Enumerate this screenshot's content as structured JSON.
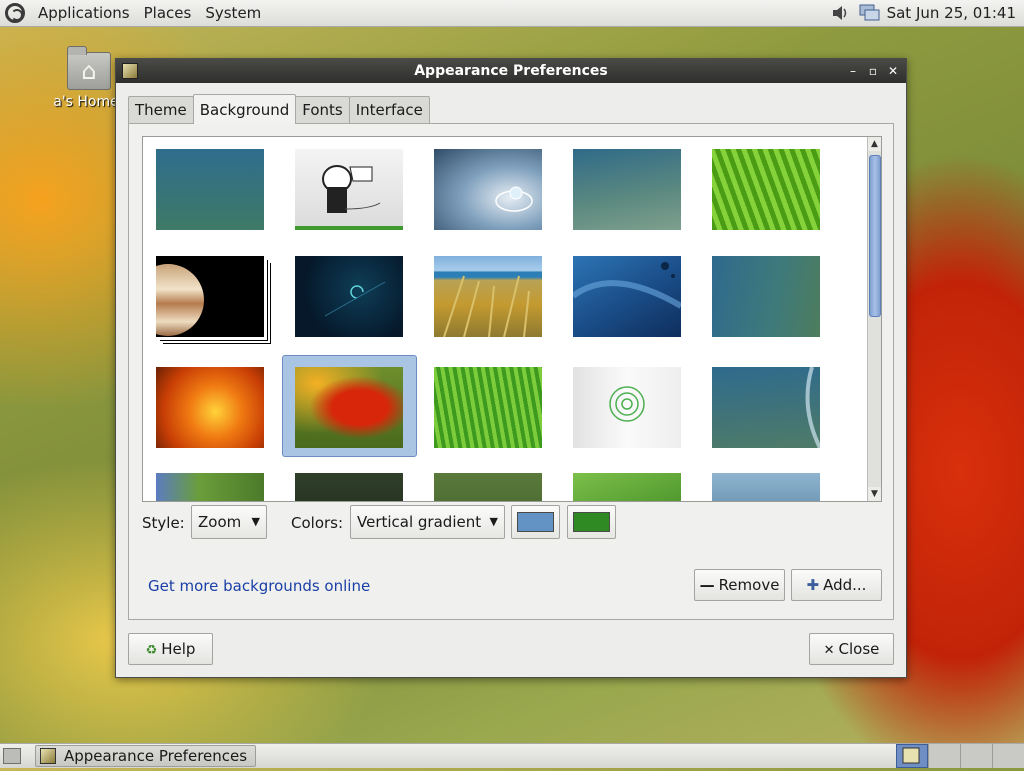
{
  "top_panel": {
    "menus": [
      "Applications",
      "Places",
      "System"
    ],
    "clock": "Sat Jun 25, 01:41"
  },
  "desktop": {
    "home_label": "a's Home"
  },
  "window": {
    "title": "Appearance Preferences",
    "controls": {
      "minimize": "–",
      "maximize": "▫",
      "close": "✕"
    },
    "tabs": [
      "Theme",
      "Background",
      "Fonts",
      "Interface"
    ],
    "active_tab": "Background",
    "selected_wallpaper_index": 11,
    "style_label": "Style:",
    "style_value": "Zoom",
    "colors_label": "Colors:",
    "colors_value": "Vertical gradient",
    "primary_color": "#6393c5",
    "secondary_color": "#2f8a24",
    "link_text": "Get more backgrounds online",
    "remove_label": "Remove",
    "add_label": "Add...",
    "help_label": "Help",
    "close_label": "Close"
  },
  "taskbar": {
    "task_label": "Appearance Preferences",
    "workspaces": 4,
    "active_workspace": 1
  }
}
